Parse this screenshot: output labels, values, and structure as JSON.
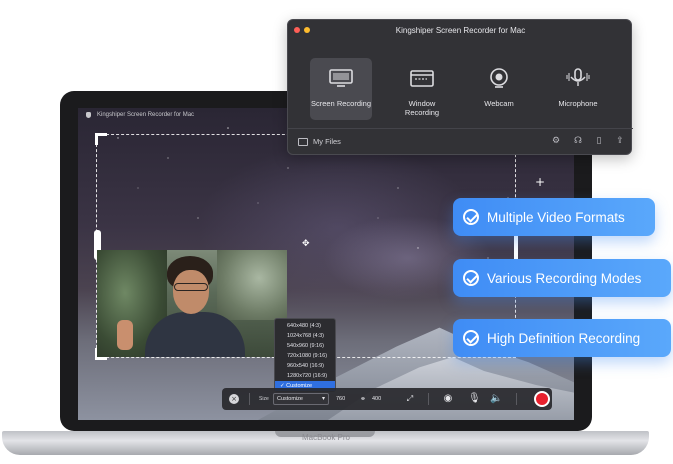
{
  "recorder": {
    "title": "Kingshiper Screen Recorder for Mac",
    "modes": [
      {
        "label": "Screen Recording",
        "icon": "monitor-icon",
        "active": true
      },
      {
        "label": "Window Recording",
        "icon": "window-icon",
        "active": false
      },
      {
        "label": "Webcam",
        "icon": "webcam-icon",
        "active": false
      },
      {
        "label": "Microphone",
        "icon": "microphone-icon",
        "active": false
      }
    ],
    "footer": {
      "files_label": "My Files"
    }
  },
  "screen": {
    "app_title": "Kingshiper Screen Recorder for Mac",
    "size_options": [
      "640x480 (4:3)",
      "1024x768 (4:3)",
      "540x960 (9:16)",
      "720x1080 (9:16)",
      "960x540 (16:9)",
      "1280x720 (16:9)",
      "Customize"
    ],
    "selected_option": "Customize"
  },
  "toolbar": {
    "size_label": "Size",
    "size_value": "Customize",
    "width": "760",
    "height": "400"
  },
  "features": [
    "Multiple Video Formats",
    "Various Recording Modes",
    "High Definition Recording"
  ],
  "laptop": {
    "model_label": "MacBook Pro"
  },
  "colors": {
    "accent": "#3f8cf5",
    "record": "#e8212e",
    "window_bg": "#323236"
  }
}
